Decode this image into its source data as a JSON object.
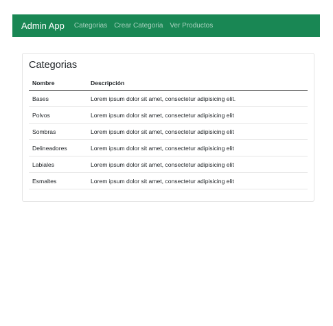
{
  "navbar": {
    "brand": "Admin App",
    "links": [
      "Categorias",
      "Crear Categoria",
      "Ver Productos"
    ],
    "background": "#198754"
  },
  "card": {
    "title": "Categorias",
    "table": {
      "headers": [
        "Nombre",
        "Descripción"
      ],
      "rows": [
        [
          "Bases",
          "Lorem ipsum dolor sit amet, consectetur adipisicing elit."
        ],
        [
          "Polvos",
          "Lorem ipsum dolor sit amet, consectetur adipisicing elit"
        ],
        [
          "Sombras",
          "Lorem ipsum dolor sit amet, consectetur adipisicing elit"
        ],
        [
          "Delineadores",
          "Lorem ipsum dolor sit amet, consectetur adipisicing elit"
        ],
        [
          "Labiales",
          "Lorem ipsum dolor sit amet, consectetur adipisicing elit"
        ],
        [
          "Esmaltes",
          "Lorem ipsum dolor sit amet, consectetur adipisicing elit"
        ]
      ]
    }
  }
}
